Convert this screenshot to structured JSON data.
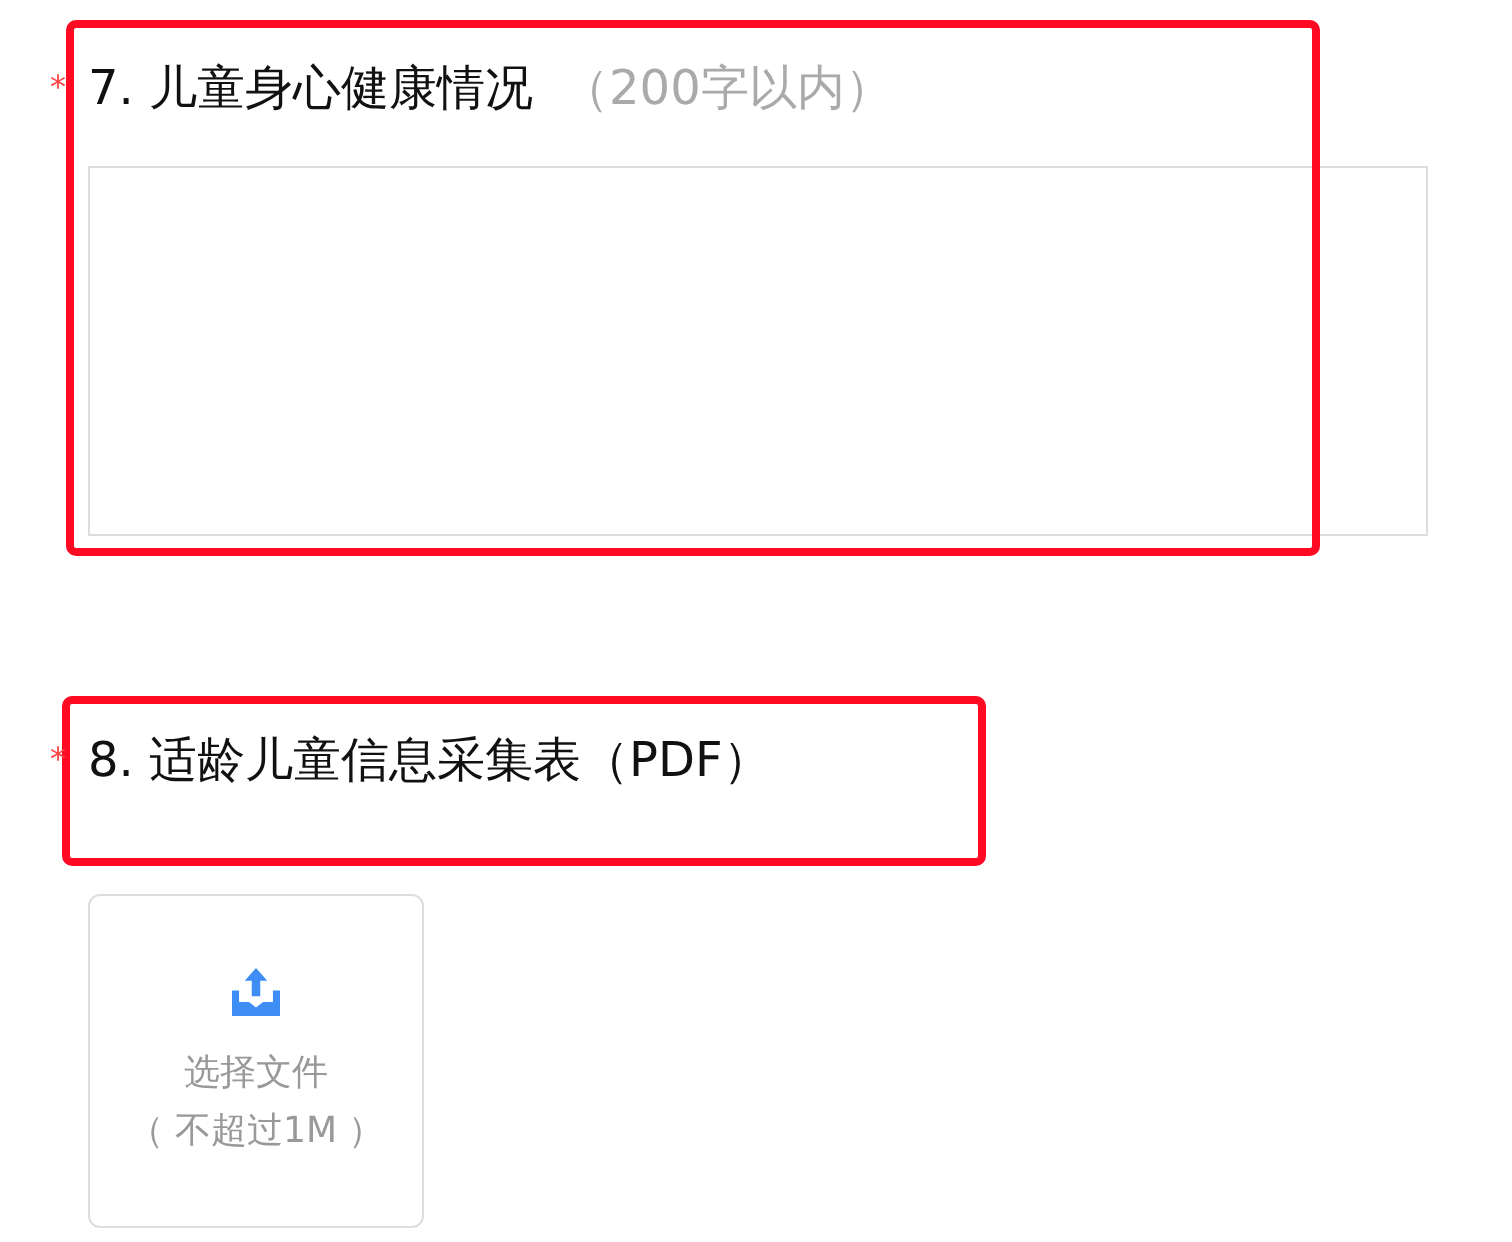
{
  "questions": [
    {
      "kind": "textarea",
      "required_mark": "*",
      "title": "7. 儿童身心健康情况",
      "hint": "（200字以内）",
      "highlighted": true
    },
    {
      "kind": "upload",
      "required_mark": "*",
      "title": "8. 适龄儿童信息采集表（PDF）",
      "highlighted": true,
      "upload": {
        "label": "选择文件",
        "note": "（ 不超过1M ）"
      }
    }
  ]
}
